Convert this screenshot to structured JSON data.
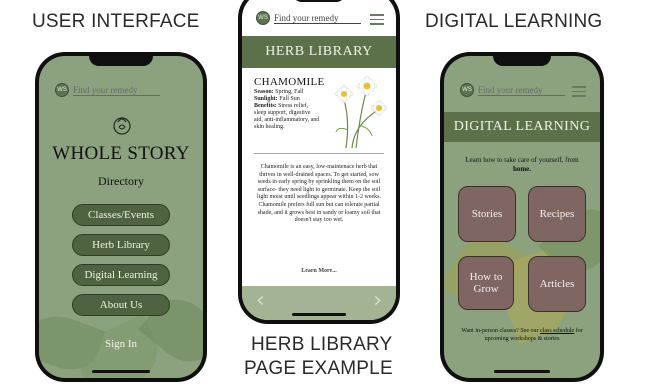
{
  "captions": {
    "left": "USER INTERFACE",
    "right": "DIGITAL LEARNING",
    "middle_line1": "HERB LIBRARY",
    "middle_line2": "PAGE EXAMPLE"
  },
  "search": {
    "placeholder": "Find your remedy",
    "logo_letters": "WS"
  },
  "home": {
    "brand": "WHOLE STORY",
    "directory": "Directory",
    "buttons": [
      "Classes/Events",
      "Herb Library",
      "Digital Learning",
      "About Us"
    ],
    "sign_in": "Sign In"
  },
  "herb_library": {
    "header": "HERB LIBRARY",
    "herb_name": "CHAMOMILE",
    "season_label": "Season:",
    "season_value": "Spring, Fall",
    "sunlight_label": "Sunlight:",
    "sunlight_value": "Full Sun",
    "benefits_label": "Benefits:",
    "benefits_value": "Stress relief, sleep support, digestive aid, anti-inflammatory, and skin healing.",
    "description": "Chamomile is an easy, low-maintenace herb that thrives in well-drained spaces. To get started, sow seeds in early spring by sprinkling them on the soil surface- they need light to germinate. Keep the soil light moist until seedlings appear within 1-2 weeks. Chamomile prefers full sun but can tolerate partial shade, and it grows best in sandy or loamy soil that doesn't stay too wet.",
    "learn_more": "Learn More...",
    "prev_arrow": "‹",
    "next_arrow": "›"
  },
  "digital_learning": {
    "header": "DIGITAL LEARNING",
    "intro_prefix": "Learn how to take care of yourself, from ",
    "intro_bold": "home.",
    "tiles": [
      "Stories",
      "Recipes",
      "How to Grow",
      "Articles"
    ],
    "footer_prefix": "Want in-person classes? See our ",
    "footer_link": "class schedule",
    "footer_suffix": " for upcoming workshops & stories"
  },
  "colors": {
    "sage": "#8aa07b",
    "dark_green": "#4f6340",
    "header_green": "#5c7049",
    "tile_mauve": "#806663"
  }
}
